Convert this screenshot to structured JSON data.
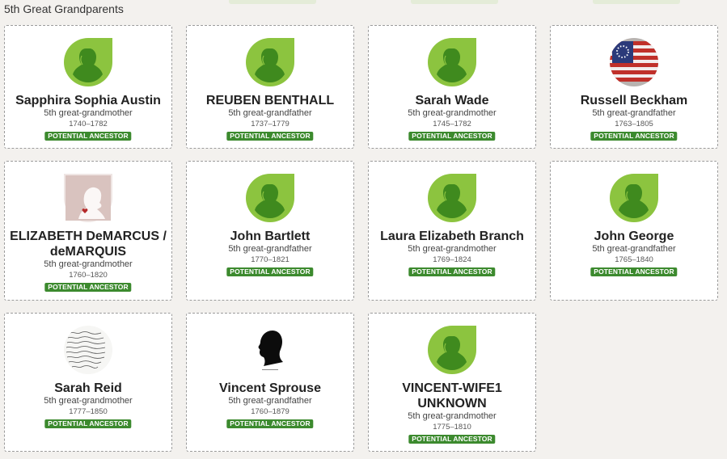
{
  "section": {
    "title": "5th Great Grandparents"
  },
  "colors": {
    "leaf_light": "#8cc43f",
    "leaf_dark": "#3f8a1e",
    "badge": "#3c8a2e"
  },
  "people": [
    {
      "name": "Sapphira Sophia Austin",
      "relationship": "5th great-grandmother",
      "dates": "1740–1782",
      "badge": "POTENTIAL ANCESTOR",
      "photo": "default-female-leaf-icon"
    },
    {
      "name": "REUBEN BENTHALL",
      "relationship": "5th great-grandfather",
      "dates": "1737–1779",
      "badge": "POTENTIAL ANCESTOR",
      "photo": "default-female-leaf-icon"
    },
    {
      "name": "Sarah Wade",
      "relationship": "5th great-grandmother",
      "dates": "1745–1782",
      "badge": "POTENTIAL ANCESTOR",
      "photo": "default-female-leaf-icon"
    },
    {
      "name": "Russell Beckham",
      "relationship": "5th great-grandfather",
      "dates": "1763–1805",
      "badge": "POTENTIAL ANCESTOR",
      "photo": "early-us-flag-photo"
    },
    {
      "name": "ELIZABETH DeMARCUS / deMARQUIS",
      "relationship": "5th great-grandmother",
      "dates": "1760–1820",
      "badge": "POTENTIAL ANCESTOR",
      "photo": "silhouette-heart-photo"
    },
    {
      "name": "John Bartlett",
      "relationship": "5th great-grandfather",
      "dates": "1770–1821",
      "badge": "POTENTIAL ANCESTOR",
      "photo": "default-female-leaf-icon"
    },
    {
      "name": "Laura Elizabeth Branch",
      "relationship": "5th great-grandmother",
      "dates": "1769–1824",
      "badge": "POTENTIAL ANCESTOR",
      "photo": "default-female-leaf-icon"
    },
    {
      "name": "John George",
      "relationship": "5th great-grandfather",
      "dates": "1765–1840",
      "badge": "POTENTIAL ANCESTOR",
      "photo": "default-female-leaf-icon"
    },
    {
      "name": "Sarah Reid",
      "relationship": "5th great-grandmother",
      "dates": "1777–1850",
      "badge": "POTENTIAL ANCESTOR",
      "photo": "handwritten-document-photo"
    },
    {
      "name": "Vincent Sprouse",
      "relationship": "5th great-grandfather",
      "dates": "1760–1879",
      "badge": "POTENTIAL ANCESTOR",
      "photo": "black-silhouette-photo"
    },
    {
      "name": "VINCENT-WIFE1 UNKNOWN",
      "relationship": "5th great-grandmother",
      "dates": "1775–1810",
      "badge": "POTENTIAL ANCESTOR",
      "photo": "default-female-leaf-icon"
    }
  ]
}
